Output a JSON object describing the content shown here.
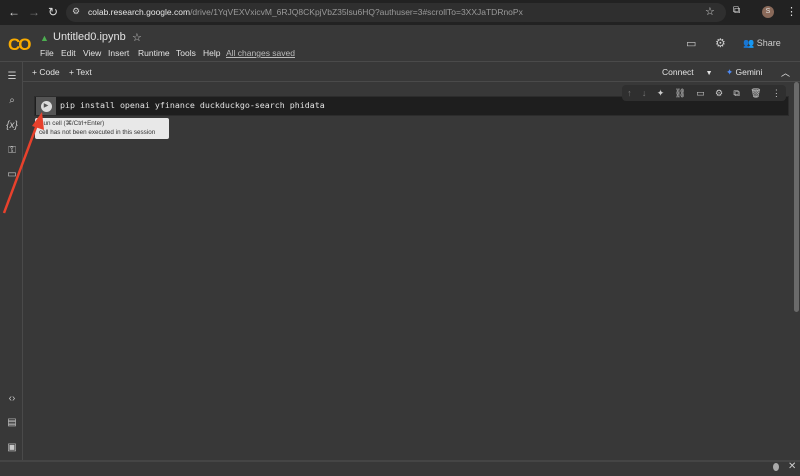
{
  "browser": {
    "url_host": "colab.research.google.com",
    "url_path": "/drive/1YqVEXVxicvM_6RJQ8CKpjVbZ35lsu6HQ?authuser=3#scrollTo=3XXJaTDRnoPx",
    "avatar_letter": "S"
  },
  "notebook": {
    "logo": "CO",
    "title": "Untitled0.ipynb",
    "menus": [
      "File",
      "Edit",
      "View",
      "Insert",
      "Runtime",
      "Tools",
      "Help"
    ],
    "save_status": "All changes saved",
    "share_label": "Share"
  },
  "toolbar": {
    "code_label": "+ Code",
    "text_label": "+ Text",
    "connect_label": "Connect",
    "gemini_label": "Gemini"
  },
  "cell": {
    "code": "pip install openai yfinance duckduckgo-search phidata",
    "tooltip_line1": "Run cell (⌘/Ctrl+Enter)",
    "tooltip_line2": "cell has not been executed in this session"
  },
  "colors": {
    "accent": "#f9ab00",
    "annotation_arrow": "#e8412c"
  }
}
